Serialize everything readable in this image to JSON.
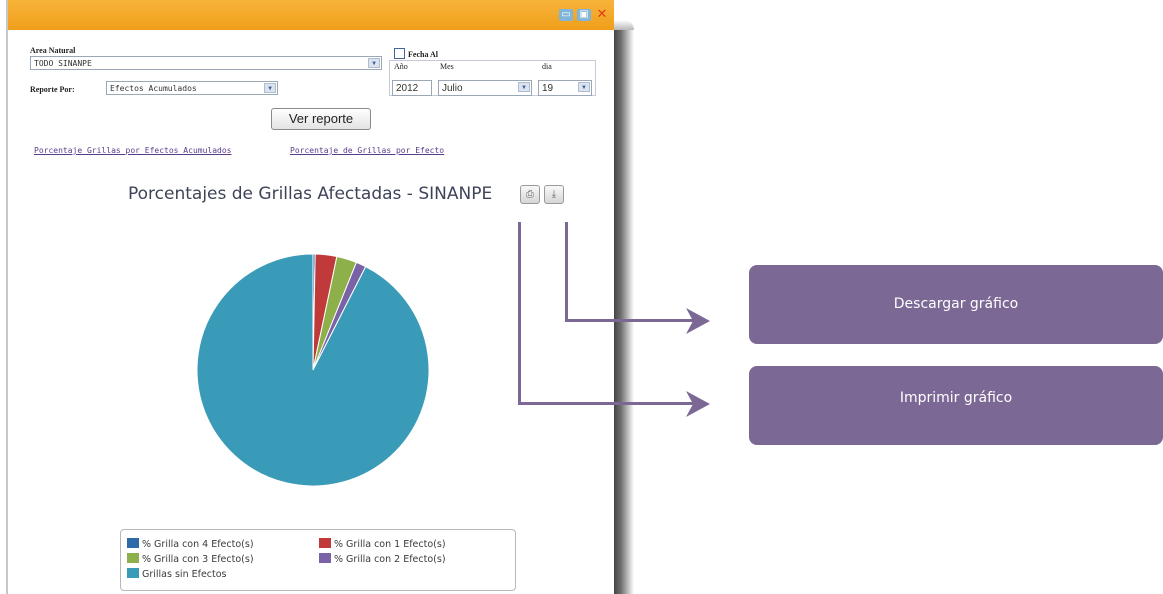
{
  "window": {
    "controls": {
      "minimize": "▭",
      "maximize": "▣",
      "close": "✕"
    }
  },
  "form": {
    "area_label": "Area Natural",
    "area_value": "TODO SINANPE",
    "reporte_label": "Reporte Por:",
    "reporte_value": "Efectos Acumulados",
    "fecha_label": "Fecha Al",
    "anio_label": "Año",
    "mes_label": "Mes",
    "dia_label": "dia",
    "anio_value": "2012",
    "mes_value": "Julio",
    "dia_value": "19",
    "ver_reporte": "Ver reporte"
  },
  "links": [
    "Porcentaje Grillas por Efectos Acumulados",
    "Porcentaje de Grillas por Efecto"
  ],
  "chart_buttons": {
    "print_icon": "printer-icon",
    "download_icon": "download-icon"
  },
  "chart_data": {
    "type": "pie",
    "title": "Porcentajes de Grillas Afectadas - SINANPE",
    "slices": [
      {
        "name": "% Grilla con 4 Efecto(s)",
        "value": 0.3,
        "color": "#2f6aa8"
      },
      {
        "name": "% Grilla con 1 Efecto(s)",
        "value": 3.0,
        "color": "#c03a3a"
      },
      {
        "name": "% Grilla con 3 Efecto(s)",
        "value": 2.8,
        "color": "#8db04a"
      },
      {
        "name": "% Grilla con 2 Efecto(s)",
        "value": 1.4,
        "color": "#7a62a6"
      },
      {
        "name": "Grillas sin Efectos",
        "value": 92.5,
        "color": "#3a9bb8"
      }
    ],
    "legend_position": "bottom"
  },
  "callouts": {
    "download": "Descargar gráfico",
    "print": "Imprimir gráfico"
  },
  "colors": {
    "accent": "#7b6895",
    "titlebar": "#f09e1a"
  }
}
